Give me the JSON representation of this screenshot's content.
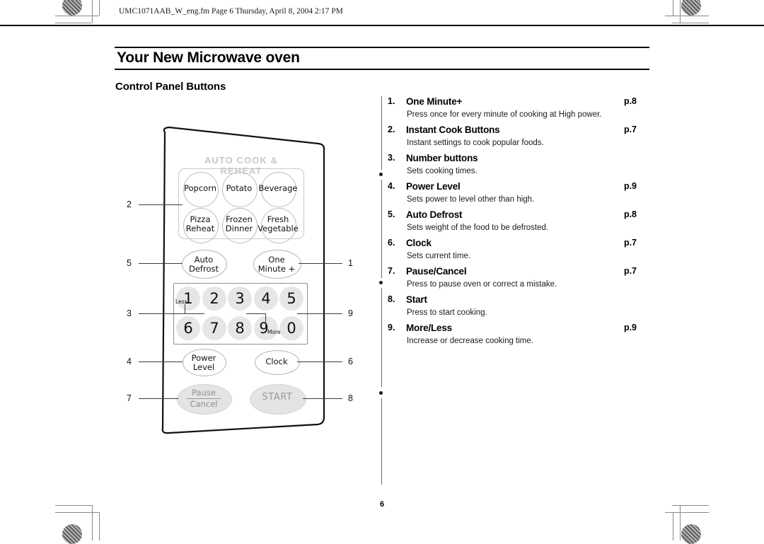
{
  "document": {
    "file_info": "UMC1071AAB_W_eng.fm  Page 6  Thursday, April 8, 2004  2:17 PM",
    "title": "Your New Microwave oven",
    "section_heading": "Control Panel Buttons",
    "page_number": "6"
  },
  "legend": {
    "items": [
      {
        "num": "1.",
        "label": "One Minute+",
        "page": "p.8",
        "desc": "Press once for every minute of cooking at High power."
      },
      {
        "num": "2.",
        "label": "Instant Cook Buttons",
        "page": "p.7",
        "desc": "Instant settings to cook popular foods."
      },
      {
        "num": "3.",
        "label": "Number buttons",
        "page": "",
        "desc": "Sets cooking times."
      },
      {
        "num": "4.",
        "label": "Power Level",
        "page": "p.9",
        "desc": "Sets power to level other than high."
      },
      {
        "num": "5.",
        "label": "Auto Defrost",
        "page": "p.8",
        "desc": "Sets weight of the food to be defrosted."
      },
      {
        "num": "6.",
        "label": "Clock",
        "page": "p.7",
        "desc": "Sets current time."
      },
      {
        "num": "7.",
        "label": "Pause/Cancel",
        "page": "p.7",
        "desc": "Press to pause oven or correct a mistake."
      },
      {
        "num": "8.",
        "label": "Start",
        "page": "",
        "desc": "Press to start cooking."
      },
      {
        "num": "9.",
        "label": "More/Less",
        "page": "p.9",
        "desc": "Increase or decrease cooking time."
      }
    ]
  },
  "control_panel": {
    "auto_cook_heading": "AUTO COOK & REHEAT",
    "instant_cook_buttons": [
      {
        "line1": "Popcorn",
        "line2": ""
      },
      {
        "line1": "Potato",
        "line2": ""
      },
      {
        "line1": "Beverage",
        "line2": ""
      },
      {
        "line1": "Pizza",
        "line2": "Reheat"
      },
      {
        "line1": "Frozen",
        "line2": "Dinner"
      },
      {
        "line1": "Fresh",
        "line2": "Vegetable"
      }
    ],
    "auto_defrost": {
      "line1": "Auto",
      "line2": "Defrost"
    },
    "one_minute": {
      "line1": "One",
      "line2": "Minute +"
    },
    "keypad_row1": [
      "1",
      "2",
      "3",
      "4",
      "5"
    ],
    "keypad_row2": [
      "6",
      "7",
      "8",
      "9",
      "0"
    ],
    "less_label": "Less",
    "more_label": "More",
    "power_level": {
      "line1": "Power",
      "line2": "Level"
    },
    "clock": {
      "line1": "Clock",
      "line2": ""
    },
    "pause_cancel": {
      "line1": "Pause",
      "line2": "Cancel"
    },
    "start": {
      "line1": "START",
      "line2": ""
    }
  },
  "callouts": {
    "left": [
      "2",
      "5",
      "3",
      "4",
      "7"
    ],
    "right": [
      "1",
      "9",
      "6",
      "8"
    ]
  },
  "colors": {
    "key_fill": "#e6e6e6",
    "heading_grey": "#c9c9c9",
    "outline": "#b3b3b3",
    "text": "#111111"
  }
}
